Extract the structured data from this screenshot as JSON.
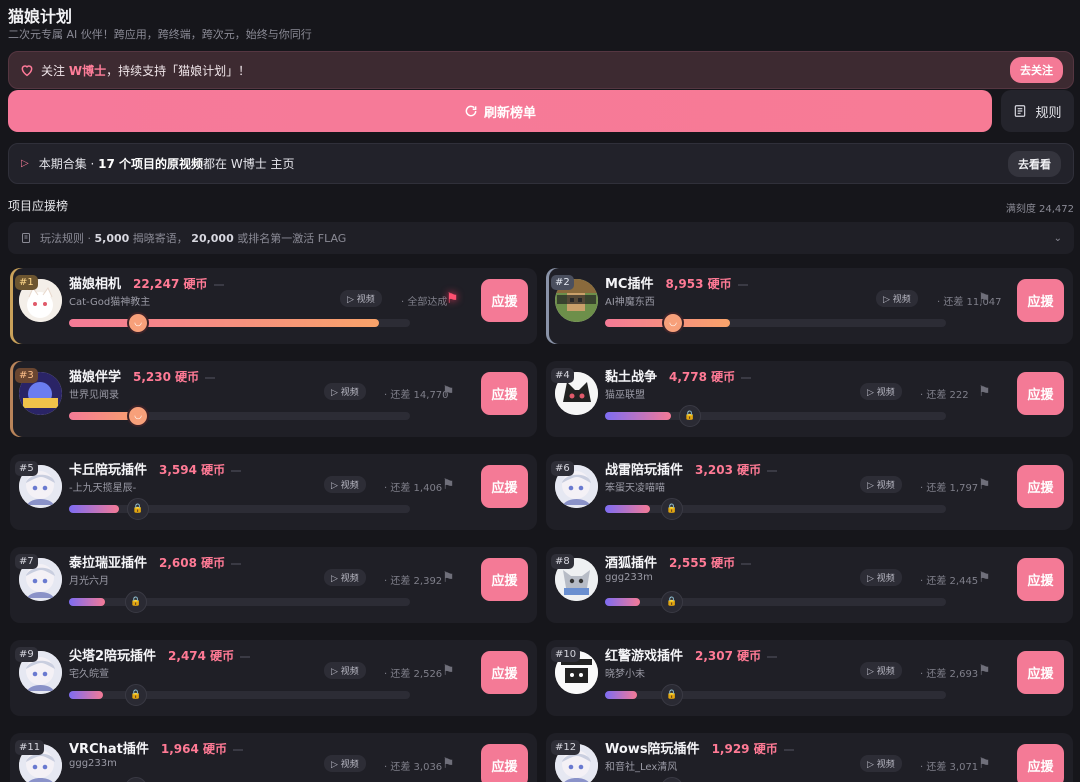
{
  "app": {
    "title": "猫娘计划",
    "subtitle": "二次元专属 AI 伙伴！跨应用，跨终端，跨次元，始终与你同行"
  },
  "follow": {
    "prefix": "关注 ",
    "name": "W博士",
    "suffix": "，持续支持「猫娘计划」！",
    "button": "去关注"
  },
  "refresh_label": "刷新榜单",
  "rules_label": "规则",
  "collection": {
    "prefix": "本期合集 · ",
    "bold": "17 个项目的原视频",
    "suffix": "都在 W博士 主页",
    "button": "去看看"
  },
  "section": {
    "title": "项目应援榜",
    "fullness": "满刻度 24,472"
  },
  "play_rules": {
    "prefix": "玩法规则 · ",
    "a": "5,000",
    "mid": " 揭晓寄语， ",
    "b": "20,000",
    "suffix": " 或排名第一激活 FLAG"
  },
  "labels": {
    "video": "视频",
    "cheer": "应援"
  },
  "accent": "#f47a96",
  "cards": [
    {
      "rank": "#1",
      "name": "猫娘相机",
      "coins": "22,247 硬币",
      "author": "Cat-God猫神教主",
      "gap": "· 全部达成",
      "progress": 0.909,
      "avatar": "cat-white-avatar"
    },
    {
      "rank": "#2",
      "name": "MC插件",
      "coins": "8,953 硬币",
      "author": "AI神魔东西",
      "gap": "· 还差 11,047",
      "progress": 0.366,
      "avatar": "minecraft-avatar"
    },
    {
      "rank": "#3",
      "name": "猫娘伴学",
      "coins": "5,230 硬币",
      "author": "世界见闻录",
      "gap": "· 还差 14,770",
      "progress": 0.214,
      "avatar": "world-avatar"
    },
    {
      "rank": "#4",
      "name": "黏土战争",
      "coins": "4,778 硬币",
      "author": "猫巫联盟",
      "gap": "· 还差 222",
      "progress": 0.195,
      "avatar": "black-cat-avatar"
    },
    {
      "rank": "#5",
      "name": "卡丘陪玩插件",
      "coins": "3,594 硬币",
      "author": "-上九天揽星辰-",
      "gap": "· 还差 1,406",
      "progress": 0.147,
      "avatar": "anime-girl-avatar"
    },
    {
      "rank": "#6",
      "name": "战雷陪玩插件",
      "coins": "3,203 硬币",
      "author": "笨蛋天凌喵喵",
      "gap": "· 还差 1,797",
      "progress": 0.131,
      "avatar": "anime-girl-avatar"
    },
    {
      "rank": "#7",
      "name": "泰拉瑞亚插件",
      "coins": "2,608 硬币",
      "author": "月光六月",
      "gap": "· 还差 2,392",
      "progress": 0.107,
      "avatar": "anime-girl-avatar"
    },
    {
      "rank": "#8",
      "name": "酒狐插件",
      "coins": "2,555 硬币",
      "author": "ggg233m",
      "gap": "· 还差 2,445",
      "progress": 0.104,
      "avatar": "fox-avatar"
    },
    {
      "rank": "#9",
      "name": "尖塔2陪玩插件",
      "coins": "2,474 硬币",
      "author": "宅久皖萱",
      "gap": "· 还差 2,526",
      "progress": 0.101,
      "avatar": "anime-girl-avatar"
    },
    {
      "rank": "#10",
      "name": "红警游戏插件",
      "coins": "2,307 硬币",
      "author": "晓梦小未",
      "gap": "· 还差 2,693",
      "progress": 0.094,
      "avatar": "manga-avatar"
    },
    {
      "rank": "#11",
      "name": "VRChat插件",
      "coins": "1,964 硬币",
      "author": "ggg233m",
      "gap": "· 还差 3,036",
      "progress": 0.08,
      "avatar": "anime-girl-avatar"
    },
    {
      "rank": "#12",
      "name": "Wows陪玩插件",
      "coins": "1,929 硬币",
      "author": "和音社_Lex清风",
      "gap": "· 还差 3,071",
      "progress": 0.079,
      "avatar": "anime-girl-avatar"
    }
  ]
}
